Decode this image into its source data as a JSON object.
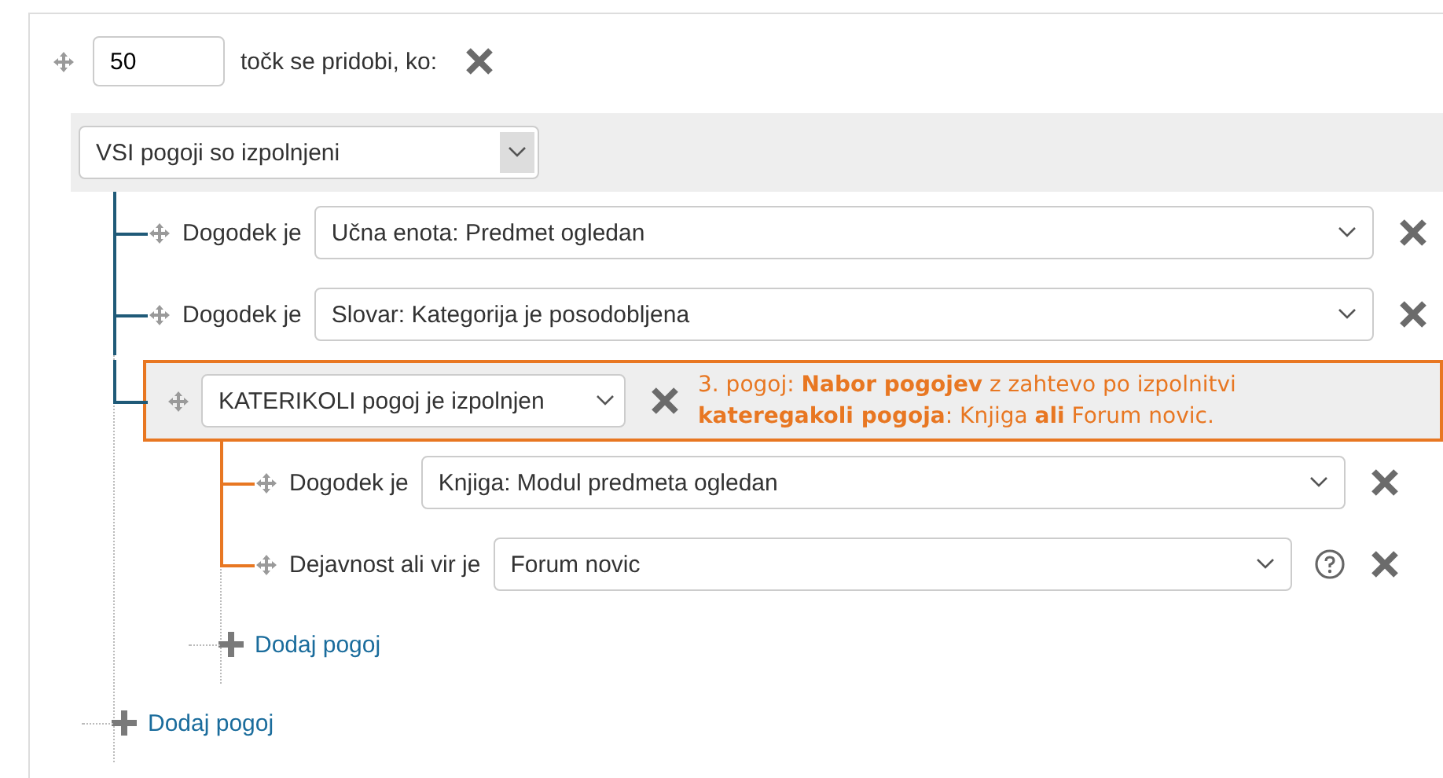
{
  "rule": {
    "points": "50",
    "label": "točk se pridobi, ko:"
  },
  "group": {
    "operator": "VSI pogoji so izpolnjeni",
    "add_label": "Dodaj pogoj",
    "conditions": [
      {
        "kind": "condition",
        "label": "Dogodek je",
        "value": "Učna enota: Predmet ogledan",
        "help": false
      },
      {
        "kind": "condition",
        "label": "Dogodek je",
        "value": "Slovar: Kategorija je posodobljena",
        "help": false
      },
      {
        "kind": "group",
        "operator": "KATERIKOLI pogoj je izpolnjen",
        "highlighted": true,
        "annotation": "3. pogoj: **Nabor pogojev** z zahtevo po izpolnitvi **kateregakoli pogoja**: Knjiga **ali** Forum novic.",
        "add_label": "Dodaj pogoj",
        "conditions": [
          {
            "kind": "condition",
            "label": "Dogodek je",
            "value": "Knjiga: Modul predmeta ogledan",
            "help": false
          },
          {
            "kind": "condition",
            "label": "Dejavnost ali vir je",
            "value": "Forum novic",
            "help": true
          }
        ]
      }
    ]
  }
}
